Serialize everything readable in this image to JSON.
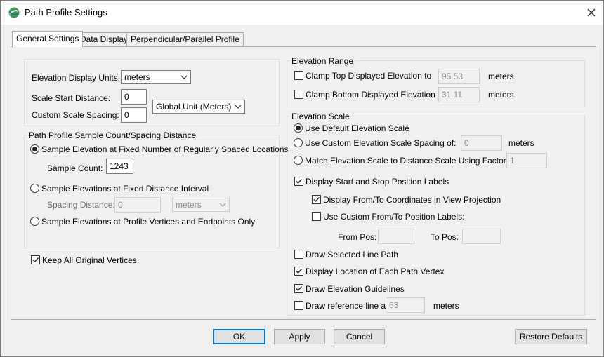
{
  "window": {
    "title": "Path Profile Settings"
  },
  "tabs": [
    {
      "label": "General Settings",
      "active": true
    },
    {
      "label": "Data Display",
      "active": false
    },
    {
      "label": "Perpendicular/Parallel Profile",
      "active": false
    }
  ],
  "units": {
    "elevation_display_units_label": "Elevation Display Units:",
    "elevation_display_units_value": "meters",
    "scale_start_label": "Scale Start Distance:",
    "scale_start_value": "0",
    "custom_spacing_label": "Custom Scale Spacing:",
    "custom_spacing_value": "0",
    "distance_unit_value": "Global Unit (Meters)"
  },
  "sample": {
    "group_title": "Path Profile Sample Count/Spacing Distance",
    "fixed_count_label": "Sample Elevation at Fixed Number of Regularly Spaced Locations",
    "sample_count_label": "Sample Count:",
    "sample_count_value": "1243",
    "fixed_distance_label": "Sample Elevations at Fixed Distance Interval",
    "spacing_distance_label": "Spacing Distance:",
    "spacing_distance_value": "0",
    "spacing_unit_value": "meters",
    "vertices_label": "Sample Elevations at Profile Vertices and Endpoints Only",
    "selected": "fixed_count"
  },
  "keep_vertices": {
    "label": "Keep All Original Vertices",
    "checked": true
  },
  "elevation_range": {
    "group_title": "Elevation Range",
    "clamp_top_label": "Clamp Top Displayed Elevation to",
    "clamp_top_value": "95.53",
    "clamp_top_checked": false,
    "clamp_bottom_label": "Clamp Bottom Displayed Elevation to",
    "clamp_bottom_value": "31.11",
    "clamp_bottom_checked": false,
    "unit": "meters"
  },
  "elevation_scale": {
    "group_title": "Elevation Scale",
    "default_label": "Use Default Elevation Scale",
    "custom_spacing_label": "Use Custom Elevation Scale Spacing of:",
    "custom_spacing_value": "0",
    "custom_spacing_unit": "meters",
    "match_label": "Match Elevation Scale to Distance Scale Using Factor of:",
    "match_value": "1",
    "selected": "default"
  },
  "position_labels": {
    "display_start_stop_label": "Display Start and Stop Position Labels",
    "display_start_stop_checked": true,
    "view_projection_label": "Display From/To Coordinates in View Projection",
    "view_projection_checked": true,
    "custom_labels_label": "Use Custom From/To Position Labels:",
    "custom_labels_checked": false,
    "from_pos_label": "From Pos:",
    "from_pos_value": "",
    "to_pos_label": "To Pos:",
    "to_pos_value": ""
  },
  "display_options": {
    "draw_selected_line_label": "Draw Selected Line Path",
    "draw_selected_line_checked": false,
    "display_vertex_label": "Display Location of Each Path Vertex",
    "display_vertex_checked": true,
    "draw_guidelines_label": "Draw Elevation Guidelines",
    "draw_guidelines_checked": true,
    "reference_line_label": "Draw reference line at",
    "reference_line_value": "63",
    "reference_line_checked": false,
    "reference_line_unit": "meters"
  },
  "buttons": {
    "ok": "OK",
    "apply": "Apply",
    "cancel": "Cancel",
    "restore_defaults": "Restore Defaults"
  }
}
